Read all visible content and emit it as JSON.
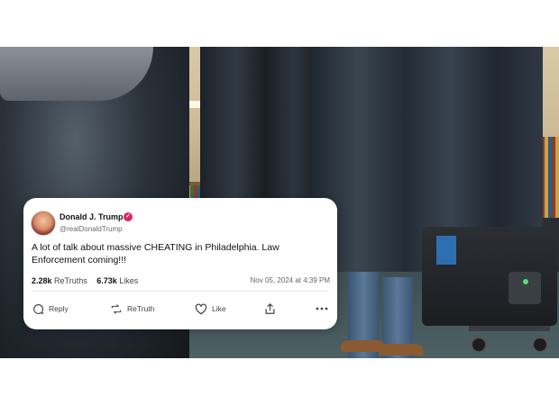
{
  "post": {
    "display_name": "Donald J. Trump",
    "handle": "@realDonaldTrump",
    "text": "A lot of talk about massive CHEATING in Philadelphia. Law Enforcement coming!!!",
    "retruths_count": "2.28k",
    "retruths_label": "ReTruths",
    "likes_count": "6.73k",
    "likes_label": "Likes",
    "timestamp": "Nov 05, 2024 at 4:39 PM",
    "verified_icon": "verified-badge-icon"
  },
  "actions": {
    "reply": "Reply",
    "retruth": "ReTruth",
    "like": "Like",
    "share_icon": "share-icon",
    "more_icon": "more-icon"
  },
  "colors": {
    "verified": "#e0245e",
    "card_bg": "#ffffff",
    "text": "#111111",
    "muted": "#6b6b6b"
  }
}
